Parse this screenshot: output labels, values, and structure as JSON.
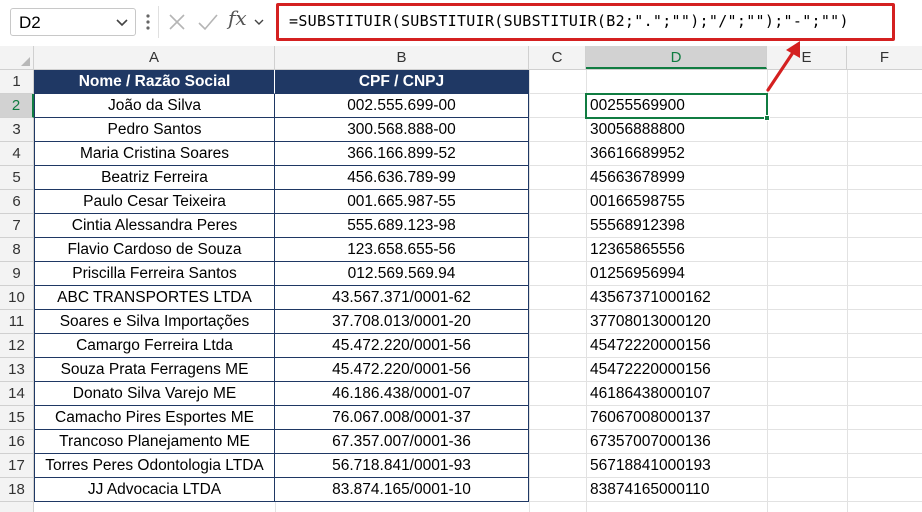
{
  "formula_bar": {
    "name_box": "D2",
    "fx_label": "fx",
    "formula": "=SUBSTITUIR(SUBSTITUIR(SUBSTITUIR(B2;\".\";\"\");\"/\";\"\");\"-\";\"\")"
  },
  "columns": [
    "A",
    "B",
    "C",
    "D",
    "E",
    "F"
  ],
  "rows": [
    "1",
    "2",
    "3",
    "4",
    "5",
    "6",
    "7",
    "8",
    "9",
    "10",
    "11",
    "12",
    "13",
    "14",
    "15",
    "16",
    "17",
    "18"
  ],
  "table": {
    "header": [
      "Nome / Razão Social",
      "CPF / CNPJ"
    ],
    "rows": [
      [
        "João da Silva",
        "002.555.699-00"
      ],
      [
        "Pedro Santos",
        "300.568.888-00"
      ],
      [
        "Maria Cristina Soares",
        "366.166.899-52"
      ],
      [
        "Beatriz Ferreira",
        "456.636.789-99"
      ],
      [
        "Paulo Cesar Teixeira",
        "001.665.987-55"
      ],
      [
        "Cintia Alessandra Peres",
        "555.689.123-98"
      ],
      [
        "Flavio Cardoso de Souza",
        "123.658.655-56"
      ],
      [
        "Priscilla Ferreira Santos",
        "012.569.569.94"
      ],
      [
        "ABC TRANSPORTES LTDA",
        "43.567.371/0001-62"
      ],
      [
        "Soares e Silva Importações",
        "37.708.013/0001-20"
      ],
      [
        "Camargo Ferreira Ltda",
        "45.472.220/0001-56"
      ],
      [
        "Souza Prata Ferragens ME",
        "45.472.220/0001-56"
      ],
      [
        "Donato Silva Varejo ME",
        "46.186.438/0001-07"
      ],
      [
        "Camacho Pires Esportes ME",
        "76.067.008/0001-37"
      ],
      [
        "Trancoso Planejamento ME",
        "67.357.007/0001-36"
      ],
      [
        "Torres Peres Odontologia LTDA",
        "56.718.841/0001-93"
      ],
      [
        "JJ Advocacia LTDA",
        "83.874.165/0001-10"
      ]
    ]
  },
  "column_d": [
    "00255569900",
    "30056888800",
    "36616689952",
    "45663678999",
    "00166598755",
    "55568912398",
    "12365865556",
    "01256956994",
    "43567371000162",
    "37708013000120",
    "45472220000156",
    "45472220000156",
    "46186438000107",
    "76067008000137",
    "67357007000136",
    "56718841000193",
    "83874165000110"
  ],
  "colors": {
    "header_fill": "#1f3864",
    "highlight_red": "#d42020",
    "selection_green": "#107c41"
  }
}
